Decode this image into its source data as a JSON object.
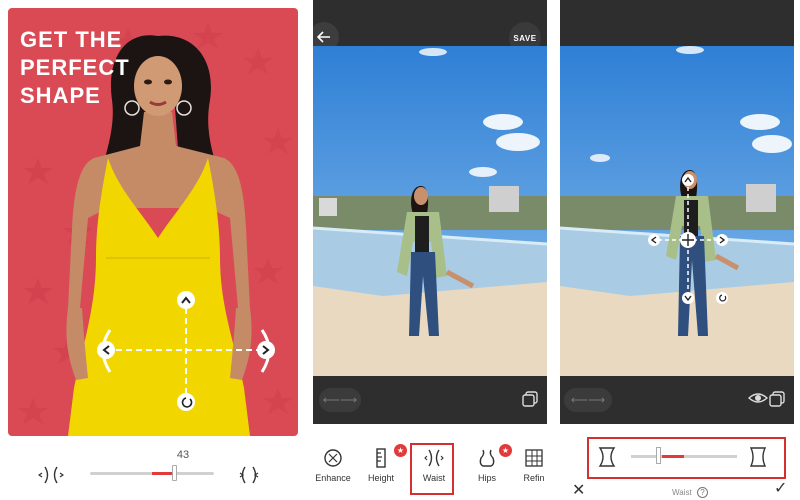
{
  "promo": {
    "headline": "GET THE\nPERFECT\nSHAPE",
    "background_color": "#d94a55",
    "dress_color": "#f2d600"
  },
  "waist_slider": {
    "value": "43",
    "fraction": 0.67,
    "left_icon": "waist-narrow-icon",
    "right_icon": "waist-wide-icon"
  },
  "editor": {
    "save_label": "SAVE",
    "back_icon": "arrow-left-icon",
    "compare_icon": "arrows-horizontal-icon",
    "copy_icon": "copy-icon"
  },
  "tools": [
    {
      "label": "Enhance",
      "icon": "enhance-icon",
      "badge": false
    },
    {
      "label": "Height",
      "icon": "ruler-icon",
      "badge": true
    },
    {
      "label": "Waist",
      "icon": "waist-icon",
      "badge": false,
      "selected": true
    },
    {
      "label": "Hips",
      "icon": "hips-icon",
      "badge": true
    },
    {
      "label": "Refin",
      "icon": "refine-icon",
      "badge": false
    }
  ],
  "waist_editor": {
    "label": "Waist",
    "help_icon": "question-icon",
    "help_glyph": "?",
    "slider_fraction": 0.24,
    "close_icon": "close-icon",
    "confirm_icon": "check-icon",
    "eye_icon": "eye-icon"
  },
  "accent_color": "#e23a3a"
}
